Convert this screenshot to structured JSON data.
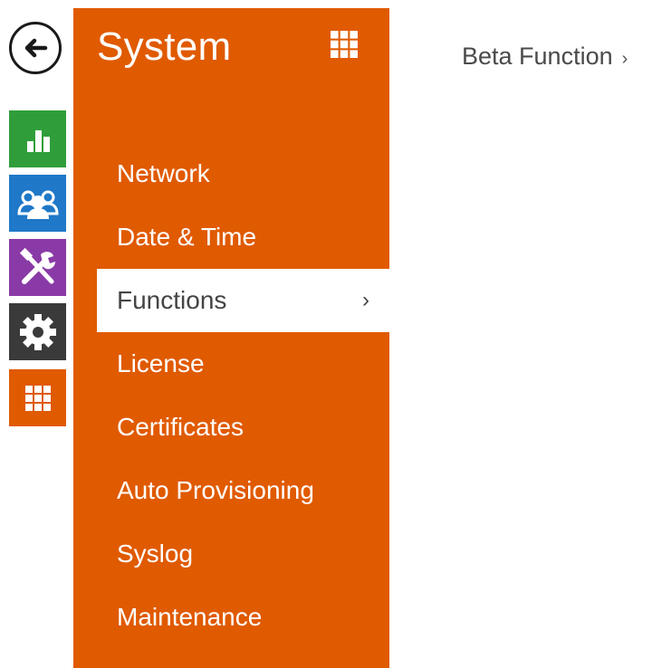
{
  "rail": {
    "back_icon": "arrow-left-icon",
    "items": [
      {
        "icon": "bar-chart-icon",
        "color": "#2f9e3a"
      },
      {
        "icon": "users-icon",
        "color": "#1f78c8"
      },
      {
        "icon": "tools-icon",
        "color": "#8a3aa6"
      },
      {
        "icon": "gear-icon",
        "color": "#3a3a3a"
      },
      {
        "icon": "grid-icon",
        "color": "#e05a00"
      }
    ]
  },
  "panel": {
    "title": "System",
    "grid_icon": "grid-icon",
    "color": "#e05a00",
    "menu": [
      {
        "label": "Network"
      },
      {
        "label": "Date & Time"
      },
      {
        "label": "Functions",
        "active": true,
        "chevron": "›"
      },
      {
        "label": "License"
      },
      {
        "label": "Certificates"
      },
      {
        "label": "Auto Provisioning"
      },
      {
        "label": "Syslog"
      },
      {
        "label": "Maintenance"
      }
    ]
  },
  "content": {
    "submenu_label": "Beta Function",
    "submenu_chevron": "›"
  }
}
